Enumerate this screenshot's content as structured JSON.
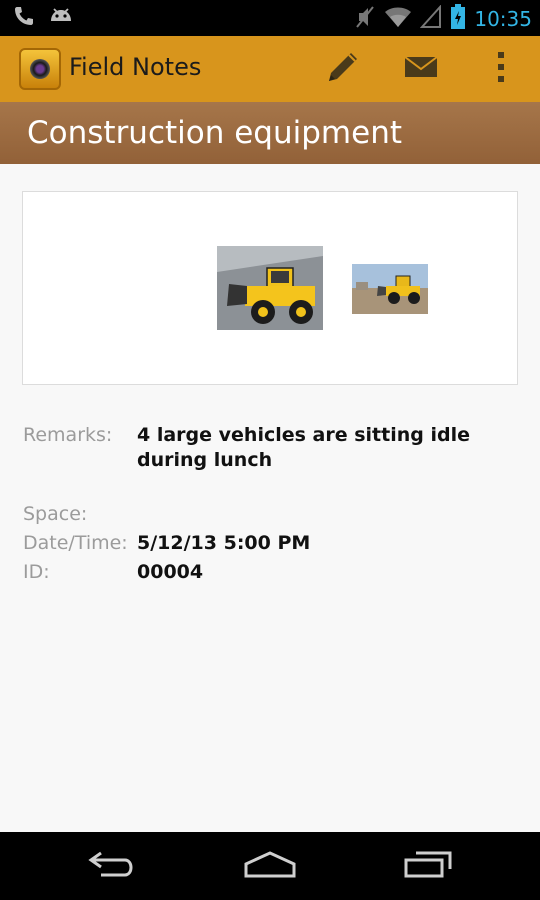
{
  "status_bar": {
    "time": "10:35",
    "icons": [
      "phone-icon",
      "android-icon",
      "mute-icon",
      "wifi-icon",
      "signal-icon",
      "battery-charging-icon"
    ]
  },
  "action_bar": {
    "app_title": "Field Notes",
    "actions": [
      "edit-pencil-icon",
      "email-icon",
      "overflow-menu-icon"
    ],
    "bar_color": "#d8951c"
  },
  "note": {
    "title": "Construction equipment",
    "photos": [
      "wheel-loader-photo",
      "wheel-loader-road-photo"
    ],
    "fields": {
      "remarks_label": "Remarks:",
      "remarks_value": "4 large vehicles are sitting idle during lunch",
      "space_label": "Space:",
      "space_value": "",
      "datetime_label": "Date/Time:",
      "datetime_value": "5/12/13 5:00 PM",
      "id_label": "ID:",
      "id_value": "00004"
    }
  },
  "nav_bar": {
    "buttons": [
      "back-icon",
      "home-icon",
      "recent-apps-icon"
    ]
  }
}
